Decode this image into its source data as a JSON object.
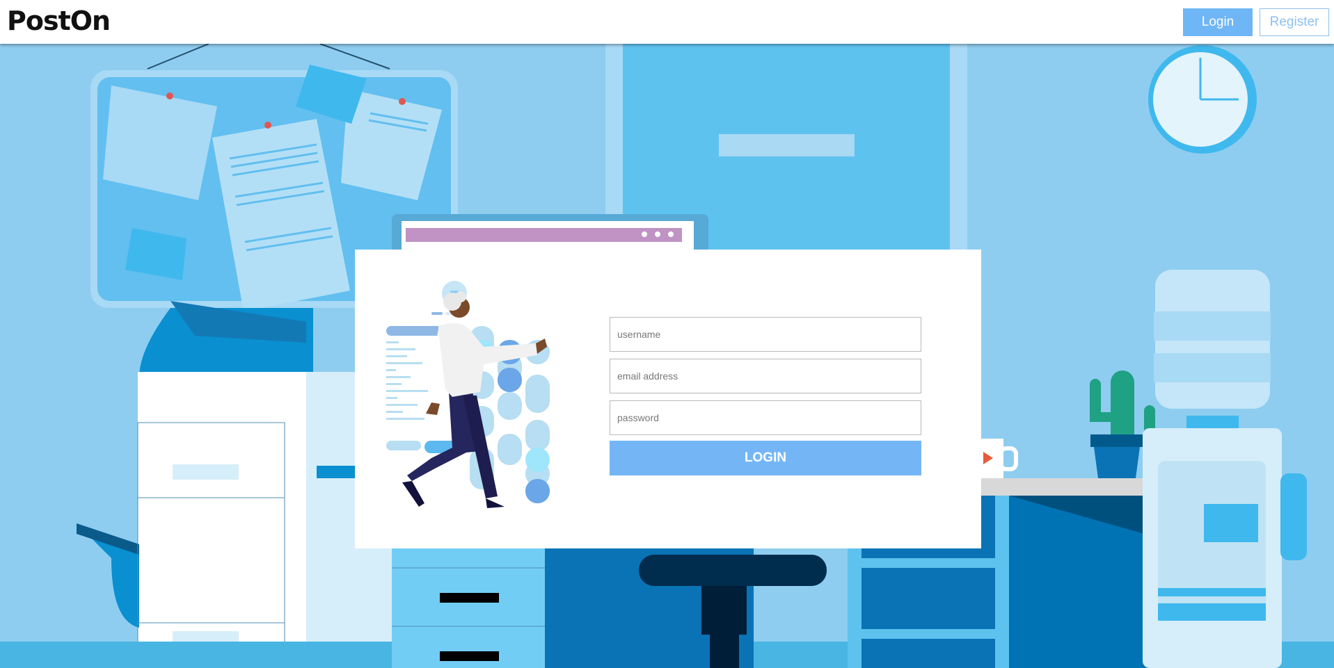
{
  "header": {
    "brand": "PostOn",
    "login_label": "Login",
    "register_label": "Register"
  },
  "form": {
    "username_placeholder": "username",
    "email_placeholder": "email address",
    "password_placeholder": "password",
    "submit_label": "LOGIN"
  },
  "colors": {
    "accent": "#74b6f5",
    "background": "#8ecdf0"
  }
}
